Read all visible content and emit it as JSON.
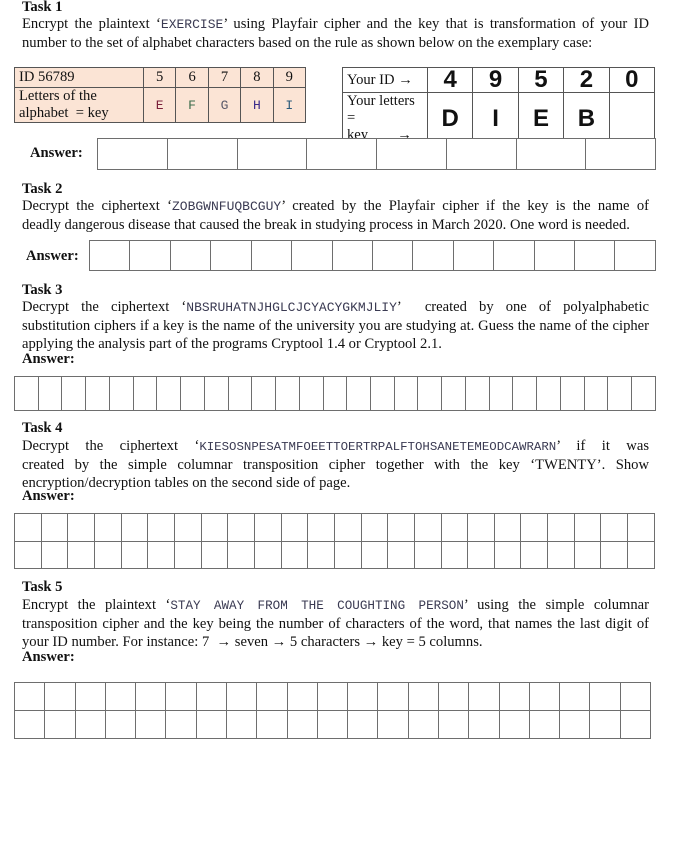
{
  "task1": {
    "title": "Task 1",
    "text_before": "Encrypt the plaintext ‘",
    "plaintext": "EXERCISE",
    "text_after_line1": "’ using Playfair cipher and the key that is transformation of your ID",
    "line2": "number to the set of alphabet characters based on the rule as shown below on the exemplary case:",
    "example_table": {
      "id_label": "ID 56789",
      "letters_label_line1": "Letters of the",
      "letters_label_line2": "alphabet  = key",
      "digits": [
        "5",
        "6",
        "7",
        "8",
        "9"
      ],
      "letters": [
        "E",
        "F",
        "G",
        "H",
        "I"
      ],
      "letter_colors": [
        "#7a1f3a",
        "#3c6b4a",
        "#5a5a6a",
        "#3a2a8a",
        "#2a5a7a"
      ],
      "background": "#fbe4d5"
    },
    "your_table": {
      "id_label": "Your ID →",
      "letters_label_line1": "Your letters =",
      "letters_label_line2": "key        →",
      "digits": [
        "4",
        "9",
        "5",
        "2",
        "0"
      ],
      "letters": [
        "D",
        "I",
        "E",
        "B",
        ""
      ]
    },
    "answer_label": "Answer:",
    "answer_cells": 8
  },
  "task2": {
    "title": "Task 2",
    "text_before": "Decrypt the ciphertext ‘",
    "ciphertext": "ZOBGWNFUQBCGUY",
    "text_after_line1": "’ created by the Playfair cipher if the key is the name of",
    "line2": "deadly dangerous disease that caused the break in studying process in March 2020. One word is needed.",
    "answer_label": "Answer:",
    "answer_cells": 14
  },
  "task3": {
    "title": "Task 3",
    "text_before": "Decrypt the ciphertext ‘",
    "ciphertext": "NBSRUHATNJHGLCJCYACYGKMJLIY",
    "text_after_line1": "’  created by one of polyalphabetic",
    "line2": "substitution ciphers if a key is the name of the university you are studying at. Guess the name of the cipher",
    "line3": "applying the analysis part of the programs Cryptool 1.4 or Cryptool 2.1.",
    "answer_label": "Answer:",
    "answer_cells": 27
  },
  "task4": {
    "title": "Task 4",
    "text_before": "Decrypt the ciphertext ‘",
    "ciphertext": "KIESOSNPESATMFOEETTOERTRPALFTOHSANETEMEODCAWRARN",
    "text_after_line1": "’ if it was",
    "line2": "created by the simple columnar transposition cipher together with the key ‘TWENTY’. Show",
    "line3": "encryption/decryption tables on the second side of page.",
    "answer_label": "Answer:",
    "answer_rows": 2,
    "answer_cols": 24
  },
  "task5": {
    "title": "Task 5",
    "text_before": "Encrypt the plaintext ‘",
    "plaintext": "STAY AWAY FROM THE COUGHTING PERSON",
    "text_after_line1": "’ using the simple columnar",
    "line2": "transposition cipher and the key being the number of characters of the word, that names the last digit of",
    "line3": "your ID number. For instance: 7  → seven → 5 characters → key = 5 columns.",
    "answer_label": "Answer:",
    "answer_rows": 2,
    "answer_cols": 21
  }
}
